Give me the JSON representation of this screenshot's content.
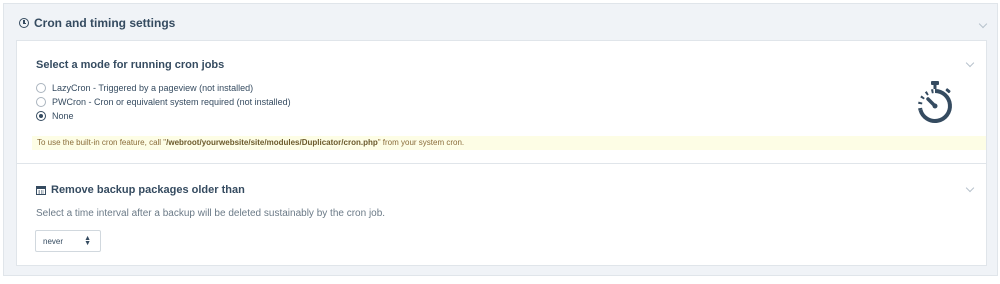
{
  "section": {
    "title": "Cron and timing settings",
    "icon": "clock-icon"
  },
  "cron_mode": {
    "title": "Select a mode for running cron jobs",
    "options": [
      {
        "label": "LazyCron - Triggered by a pageview (not installed)",
        "checked": false
      },
      {
        "label": "PWCron - Cron or equivalent system required (not installed)",
        "checked": false
      },
      {
        "label": "None",
        "checked": true
      }
    ],
    "note_prefix": "To use the built-in cron feature, call \"",
    "note_path": "/webroot/yourwebsite/site/modules/Duplicator/cron.php",
    "note_suffix": "\" from your system cron.",
    "illustration_icon": "stopwatch-icon"
  },
  "backup_retention": {
    "title": "Remove backup packages older than",
    "icon": "calendar-icon",
    "description": "Select a time interval after a backup will be deleted sustainably by the cron job.",
    "selected_value": "never"
  },
  "colors": {
    "text": "#354b60",
    "note_bg": "#fdfde5",
    "note_text": "#8a6d3b",
    "border": "#e0e5ea"
  }
}
